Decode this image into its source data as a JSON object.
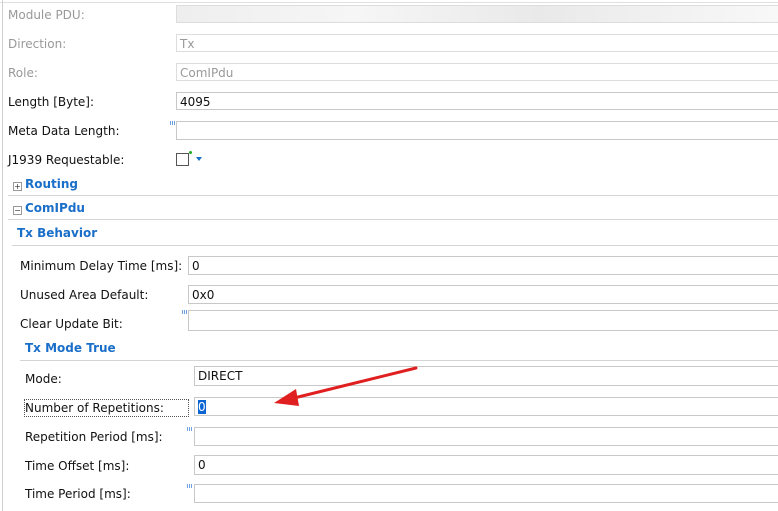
{
  "general": {
    "module_pdu": {
      "label": "Module PDU:",
      "value": ""
    },
    "direction": {
      "label": "Direction:",
      "value": "Tx"
    },
    "role": {
      "label": "Role:",
      "value": "ComIPdu"
    },
    "length": {
      "label": "Length [Byte]:",
      "value": "4095"
    },
    "meta": {
      "label": "Meta Data Length:",
      "value": ""
    },
    "j1939": {
      "label": "J1939 Requestable:",
      "checked": false
    }
  },
  "sections": {
    "routing": "Routing",
    "comipdu": "ComIPdu",
    "tx_behavior": "Tx Behavior",
    "tx_mode_true": "Tx Mode True"
  },
  "tx_behavior": {
    "min_delay": {
      "label": "Minimum Delay Time [ms]:",
      "value": "0"
    },
    "unused": {
      "label": "Unused Area Default:",
      "value": "0x0"
    },
    "clear_update": {
      "label": "Clear Update Bit:",
      "value": ""
    }
  },
  "tx_mode": {
    "mode": {
      "label": "Mode:",
      "value": "DIRECT"
    },
    "num_rep": {
      "label": "Number of Repetitions:",
      "value": "0"
    },
    "rep_period": {
      "label": "Repetition Period [ms]:",
      "value": ""
    },
    "time_offset": {
      "label": "Time Offset [ms]:",
      "value": "0"
    },
    "time_period": {
      "label": "Time Period [ms]:",
      "value": ""
    }
  },
  "colors": {
    "accent": "#1a6fc9",
    "arrow": "#e02020",
    "selection": "#0a64d2"
  }
}
